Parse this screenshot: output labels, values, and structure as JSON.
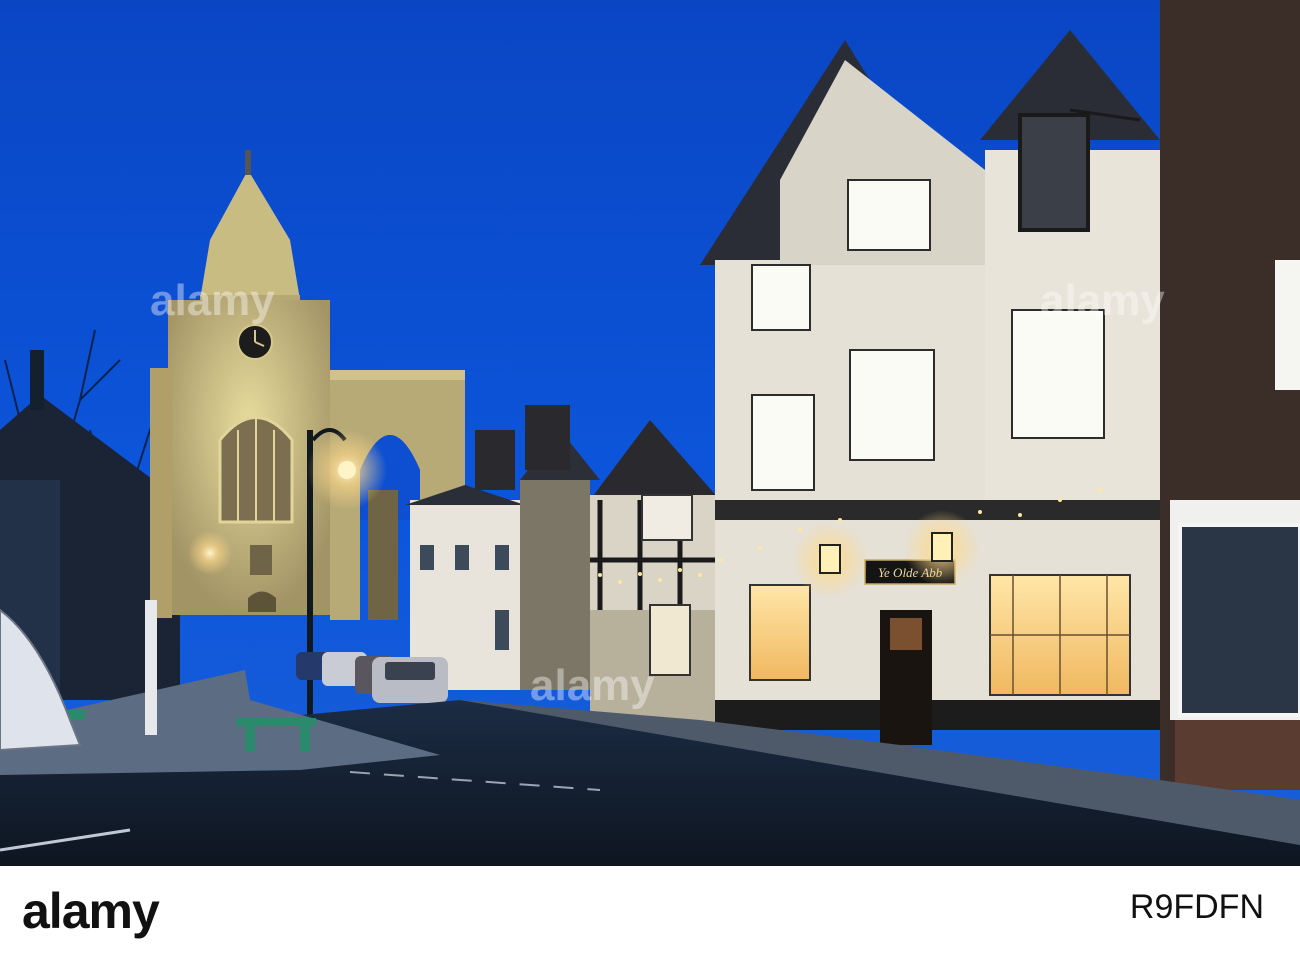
{
  "scene": {
    "pub_sign_text": "Ye Olde Abb",
    "watermark_text": "alamy"
  },
  "footer": {
    "brand": "alamy",
    "image_id": "R9FDFN"
  },
  "colors": {
    "sky": "#0b4fd1",
    "lamp_glow": "#ffd98a",
    "footer_bg": "#ffffff"
  }
}
